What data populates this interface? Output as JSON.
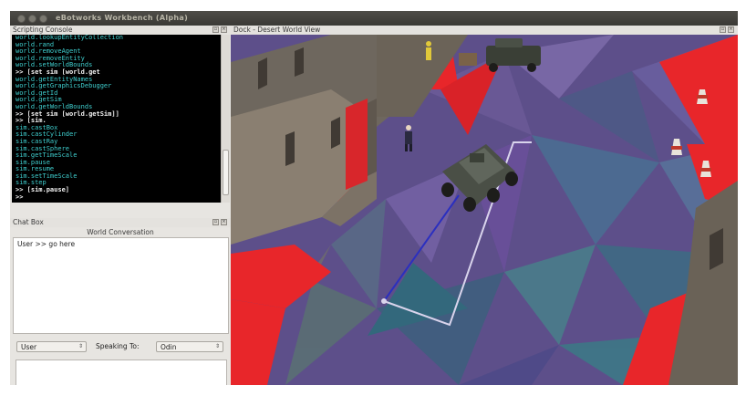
{
  "window": {
    "title": "eBotworks Workbench (Alpha)"
  },
  "scripting_console": {
    "title": "Scripting Console",
    "lines": [
      {
        "text": "world.lookupEntityCollection",
        "cmd": false
      },
      {
        "text": "world.rand",
        "cmd": false
      },
      {
        "text": "world.removeAgent",
        "cmd": false
      },
      {
        "text": "world.removeEntity",
        "cmd": false
      },
      {
        "text": "world.setWorldBounds",
        "cmd": false
      },
      {
        "text": ">> [set sim [world.get",
        "cmd": true
      },
      {
        "text": "world.getEntityNames",
        "cmd": false
      },
      {
        "text": "world.getGraphicsDebugger",
        "cmd": false
      },
      {
        "text": "world.getId",
        "cmd": false
      },
      {
        "text": "world.getSim",
        "cmd": false
      },
      {
        "text": "world.getWorldBounds",
        "cmd": false
      },
      {
        "text": ">> [set sim [world.getSim]]",
        "cmd": true
      },
      {
        "text": ">> [sim.",
        "cmd": true
      },
      {
        "text": "sim.castBox",
        "cmd": false
      },
      {
        "text": "sim.castCylinder",
        "cmd": false
      },
      {
        "text": "sim.castRay",
        "cmd": false
      },
      {
        "text": "sim.castSphere",
        "cmd": false
      },
      {
        "text": "sim.getTimeScale",
        "cmd": false
      },
      {
        "text": "sim.pause",
        "cmd": false
      },
      {
        "text": "sim.resume",
        "cmd": false
      },
      {
        "text": "sim.setTimeScale",
        "cmd": false
      },
      {
        "text": "sim.step",
        "cmd": false
      },
      {
        "text": ">> [sim.pause]",
        "cmd": true
      },
      {
        "text": ">>",
        "cmd": true
      }
    ]
  },
  "chat_box": {
    "title": "Chat Box",
    "conversation_title": "World Conversation",
    "messages": [
      "User >> go here"
    ],
    "from_value": "User",
    "speaking_to_label": "Speaking To:",
    "speaking_to_value": "Odin",
    "input_value": ""
  },
  "dock": {
    "title": "Dock - Desert World View"
  },
  "colors": {
    "floor_red": "#e8262a",
    "navmesh_purple": "#5d4f8a",
    "console_text": "#3fcfcf",
    "path_white": "#d9d4ec",
    "path_blue": "#2b2fbf"
  },
  "icons": [
    "window-close-icon",
    "window-minimize-icon",
    "window-maximize-icon",
    "panel-float-icon",
    "panel-close-icon",
    "combo-arrow-icon"
  ]
}
